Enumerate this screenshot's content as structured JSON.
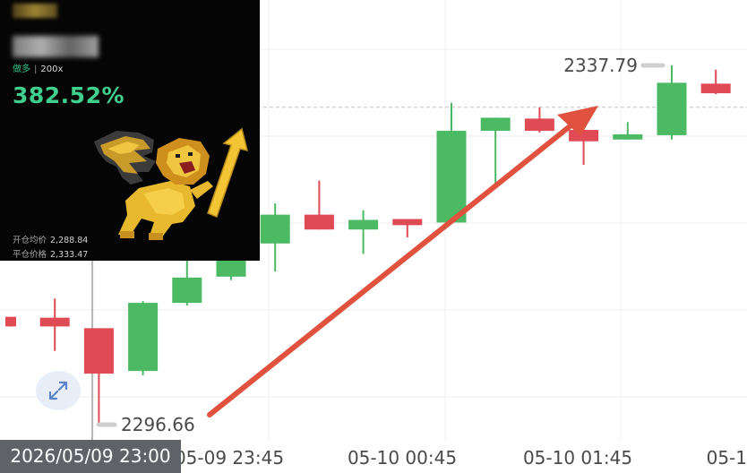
{
  "card": {
    "side": "做多",
    "separator": "|",
    "leverage": "200x",
    "pnl_percent": "382.52%",
    "entry_label": "开仓均价",
    "entry_value": "2,288.84",
    "close_label": "平仓价格",
    "close_value": "2,333.47",
    "mascot": "golden-winged-lion-holding-up-arrow"
  },
  "crosshair_time": "2026/05/09 23:00",
  "expand_icon": "expand-arrows-icon",
  "colors": {
    "up": "#4cb963",
    "down": "#df4a55",
    "arrow": "#e0523d",
    "card_green": "#3fcf8e"
  },
  "chart_data": {
    "type": "candlestick",
    "title": "",
    "xlabel": "",
    "ylabel": "",
    "x_tick_labels": [
      "05-09 23:45",
      "05-10 00:45",
      "05-10 01:45",
      "05-1"
    ],
    "ylim": [
      2294,
      2345
    ],
    "high_marker": "2337.79",
    "low_marker": "2296.66",
    "candles": [
      {
        "open": 2309.0,
        "high": 2309.0,
        "low": 2307.9,
        "close": 2307.9
      },
      {
        "open": 2308.9,
        "high": 2311.1,
        "low": 2305.1,
        "close": 2307.9
      },
      {
        "open": 2307.7,
        "high": 2307.7,
        "low": 2296.66,
        "close": 2302.5
      },
      {
        "open": 2302.8,
        "high": 2310.8,
        "low": 2302.3,
        "close": 2310.6
      },
      {
        "open": 2310.6,
        "high": 2316.4,
        "low": 2310.3,
        "close": 2313.5
      },
      {
        "open": 2313.6,
        "high": 2320.8,
        "low": 2313.2,
        "close": 2317.4
      },
      {
        "open": 2317.4,
        "high": 2322.0,
        "low": 2314.2,
        "close": 2320.7
      },
      {
        "open": 2320.7,
        "high": 2324.6,
        "low": 2319.0,
        "close": 2319.0
      },
      {
        "open": 2319.0,
        "high": 2321.2,
        "low": 2316.2,
        "close": 2320.1
      },
      {
        "open": 2320.2,
        "high": 2320.2,
        "low": 2318.1,
        "close": 2319.5
      },
      {
        "open": 2319.8,
        "high": 2333.5,
        "low": 2319.6,
        "close": 2330.3
      },
      {
        "open": 2330.3,
        "high": 2331.1,
        "low": 2324.3,
        "close": 2331.8
      },
      {
        "open": 2331.7,
        "high": 2333.0,
        "low": 2330.1,
        "close": 2330.3
      },
      {
        "open": 2330.4,
        "high": 2331.7,
        "low": 2326.4,
        "close": 2329.1
      },
      {
        "open": 2329.3,
        "high": 2331.3,
        "low": 2329.3,
        "close": 2329.9
      },
      {
        "open": 2329.8,
        "high": 2337.79,
        "low": 2329.3,
        "close": 2335.8
      },
      {
        "open": 2335.7,
        "high": 2337.3,
        "low": 2334.5,
        "close": 2334.6
      }
    ]
  }
}
